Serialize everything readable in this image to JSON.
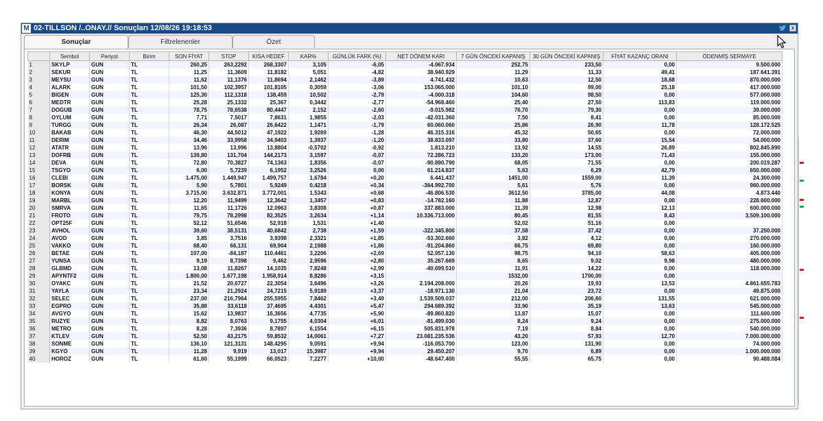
{
  "window": {
    "app_icon": "M",
    "title": "02-TILLSON /..ONAY.// Sonuçları  12/08/26 19:18:53",
    "close_label": "x"
  },
  "tabs": [
    "Sonuçlar",
    "Filtrelenenler",
    "Özet"
  ],
  "columns": [
    "",
    "Sembol",
    "Periyot",
    "Birim",
    "SON FİYAT",
    "STOP",
    "KISA HEDEF",
    "KAR%",
    "GÜNLÜK FARK (%)",
    "NET DÖNEM KARI",
    "7 GÜN ÖNCEKİ KAPANIŞ",
    "30 GÜN ÖNCEKİ KAPANIŞ",
    "FİYAT KAZANÇ ORANI",
    "ÖDENMİŞ SERMAYE"
  ],
  "rows": [
    [
      "1",
      "SKYLP",
      "GUN",
      "TL",
      "260,25",
      "263,2292",
      "268,3307",
      "3,105",
      "-6,05",
      "-4.067.934",
      "252,75",
      "233,50",
      "0,00",
      "9.500.000"
    ],
    [
      "2",
      "SEKUR",
      "GUN",
      "TL",
      "11,25",
      "11,3609",
      "11,8182",
      "5,051",
      "-4,82",
      "38.940.929",
      "11,29",
      "11,33",
      "49,41",
      "187.641.391"
    ],
    [
      "3",
      "MEYSU",
      "GUN",
      "TL",
      "11,62",
      "11,1376",
      "11,8694",
      "2,1462",
      "-3,89",
      "4.741.432",
      "10,63",
      "12,50",
      "18,68",
      "870.000.000"
    ],
    [
      "4",
      "ALARK",
      "GUN",
      "TL",
      "101,50",
      "102,3957",
      "101,8105",
      "0,3059",
      "-3,06",
      "153.065.000",
      "101,10",
      "99,00",
      "25,18",
      "417.000.000"
    ],
    [
      "5",
      "BIGEN",
      "GUN",
      "TL",
      "125,30",
      "112,1318",
      "138,459",
      "10,502",
      "-2,79",
      "-4.000.318",
      "104,60",
      "98,50",
      "0,00",
      "577.000.000"
    ],
    [
      "6",
      "MEDTR",
      "GUN",
      "TL",
      "25,28",
      "25,1332",
      "25,367",
      "0,3442",
      "-2,77",
      "-54.968.460",
      "25,40",
      "27,50",
      "113,83",
      "119.000.000"
    ],
    [
      "7",
      "DOGUB",
      "GUN",
      "TL",
      "78,75",
      "78,6538",
      "80,4447",
      "2,152",
      "-2,60",
      "-9.015.982",
      "76,70",
      "79,30",
      "0,00",
      "39.000.000"
    ],
    [
      "8",
      "OYLUM",
      "GUN",
      "TL",
      "7,71",
      "7,5017",
      "7,8631",
      "1,9855",
      "-2,03",
      "-42.031.360",
      "7,50",
      "8,41",
      "0,00",
      "85.000.000"
    ],
    [
      "9",
      "TURGG",
      "GUN",
      "TL",
      "26,34",
      "26,087",
      "26,6422",
      "1,1471",
      "-1,79",
      "60.060.060",
      "25,86",
      "26,90",
      "11,78",
      "128.172.525"
    ],
    [
      "10",
      "BAKAB",
      "GUN",
      "TL",
      "46,30",
      "44,5012",
      "47,1922",
      "1,9269",
      "-1,28",
      "46.315.316",
      "45,32",
      "50,65",
      "0,00",
      "72.000.000"
    ],
    [
      "11",
      "DERIM",
      "GUN",
      "TL",
      "34,46",
      "33,9958",
      "34,9403",
      "1,3937",
      "-1,20",
      "38.833.097",
      "33,80",
      "37,60",
      "15,54",
      "54.000.000"
    ],
    [
      "12",
      "ATATR",
      "GUN",
      "TL",
      "13,96",
      "13,996",
      "13,8804",
      "-0,5702",
      "-0,92",
      "1.813.210",
      "13,92",
      "14,55",
      "26,89",
      "802.845.890"
    ],
    [
      "13",
      "DOFRB",
      "GUN",
      "TL",
      "139,80",
      "131,704",
      "144,2173",
      "3,1597",
      "-0,07",
      "72.286.723",
      "133,20",
      "173,00",
      "71,43",
      "155.000.000"
    ],
    [
      "14",
      "DEVA",
      "GUN",
      "TL",
      "72,80",
      "70,3827",
      "74,1363",
      "1,8356",
      "-0,07",
      "-90.890.790",
      "68,05",
      "71,55",
      "0,00",
      "200.019.287"
    ],
    [
      "15",
      "TSGYO",
      "GUN",
      "TL",
      "6,00",
      "5,7239",
      "6,1952",
      "3,2526",
      "0,00",
      "61.214.837",
      "5,63",
      "6,29",
      "42,79",
      "650.000.000"
    ],
    [
      "16",
      "CLEBI",
      "GUN",
      "TL",
      "1.475,00",
      "1.449,947",
      "1.499,757",
      "1,6784",
      "+0,20",
      "6.441.437",
      "1451,00",
      "1559,00",
      "11,39",
      "24.300.000"
    ],
    [
      "17",
      "BORSK",
      "GUN",
      "TL",
      "5,90",
      "5,7801",
      "5,9249",
      "0,4218",
      "+0,34",
      "-364.992.700",
      "5,61",
      "5,76",
      "0,00",
      "960.000.000"
    ],
    [
      "18",
      "KONYA",
      "GUN",
      "TL",
      "3.715,00",
      "3.632,871",
      "3.772,001",
      "1,5343",
      "+0,68",
      "-46.806.530",
      "3612,50",
      "3785,00",
      "44,08",
      "4.873.440"
    ],
    [
      "19",
      "MARBL",
      "GUN",
      "TL",
      "12,20",
      "11,9499",
      "12,3642",
      "1,3457",
      "+0,83",
      "-14.782.160",
      "11,88",
      "12,87",
      "0,00",
      "228.600.000"
    ],
    [
      "20",
      "SMRVA",
      "GUN",
      "TL",
      "11,65",
      "11,1726",
      "12,0963",
      "3,8308",
      "+0,87",
      "337.883.000",
      "11,39",
      "12,98",
      "12,13",
      "600.000.000"
    ],
    [
      "21",
      "FROTO",
      "GUN",
      "TL",
      "79,75",
      "78,2998",
      "82,3525",
      "3,2634",
      "+1,14",
      "10.336.713.000",
      "80,45",
      "81,55",
      "8,43",
      "3.509.100.000"
    ],
    [
      "22",
      "OPT25F",
      "GUN",
      "TL",
      "52,12",
      "51,6546",
      "52,918",
      "1,531",
      "+1,40",
      "",
      "52,02",
      "51,16",
      "0,00",
      ""
    ],
    [
      "23",
      "AVHOL",
      "GUN",
      "TL",
      "39,60",
      "38,5131",
      "40,6842",
      "2,738",
      "+1,59",
      "-322.345.800",
      "37,58",
      "37,42",
      "0,00",
      "37.250.000"
    ],
    [
      "24",
      "AVOD",
      "GUN",
      "TL",
      "3,85",
      "3,7516",
      "3,9398",
      "2,3321",
      "+1,85",
      "-53.302.660",
      "3,82",
      "4,12",
      "0,00",
      "270.000.000"
    ],
    [
      "25",
      "VAKKO",
      "GUN",
      "TL",
      "68,40",
      "66,131",
      "69,904",
      "2,1988",
      "+1,86",
      "-91.204.860",
      "66,75",
      "69,80",
      "0,00",
      "160.000.000"
    ],
    [
      "26",
      "BETAE",
      "GUN",
      "TL",
      "107,00",
      "-84,187",
      "110,4461",
      "3,2206",
      "+2,69",
      "52.057.130",
      "98,75",
      "94,10",
      "58,63",
      "405.000.000"
    ],
    [
      "27",
      "YUNSA",
      "GUN",
      "TL",
      "9,19",
      "8,7398",
      "9,462",
      "2,9596",
      "+2,80",
      "35.267.669",
      "8,65",
      "9,02",
      "9,98",
      "480.000.000"
    ],
    [
      "28",
      "GLBMD",
      "GUN",
      "TL",
      "13,08",
      "11,8267",
      "14,1035",
      "7,8248",
      "+2,99",
      "-40.699.510",
      "11,91",
      "14,22",
      "0,00",
      "118.000.000"
    ],
    [
      "29",
      "APYNTF2",
      "GUN",
      "TL",
      "1.800,00",
      "1.677,198",
      "1.958,914",
      "8,8286",
      "+3,15",
      "",
      "1532,00",
      "1700,00",
      "0,00",
      ""
    ],
    [
      "30",
      "OYAKC",
      "GUN",
      "TL",
      "21,52",
      "20,6727",
      "22,3054",
      "3,6496",
      "+3,26",
      "2.194.208.000",
      "20,26",
      "19,93",
      "13,53",
      "4.861.655.783"
    ],
    [
      "31",
      "YAYLA",
      "GUN",
      "TL",
      "23,34",
      "21,2924",
      "24,7215",
      "5,9189",
      "+3,37",
      "-18.971.130",
      "21,04",
      "23,72",
      "0,00",
      "49.875.000"
    ],
    [
      "32",
      "SELEC",
      "GUN",
      "TL",
      "237,00",
      "216,7964",
      "255,5955",
      "7,8462",
      "+3,49",
      "1.539.509.037",
      "212,00",
      "206,60",
      "131,55",
      "621.000.000"
    ],
    [
      "33",
      "EGPRO",
      "GUN",
      "TL",
      "35,88",
      "33,6118",
      "37,4695",
      "4,4301",
      "+5,47",
      "294.689.392",
      "33,90",
      "35,19",
      "13,63",
      "545.000.000"
    ],
    [
      "34",
      "AVGYO",
      "GUN",
      "TL",
      "15,62",
      "13,9837",
      "16,3656",
      "4,7735",
      "+5,90",
      "-89.860.820",
      "13,87",
      "15,07",
      "0,00",
      "111.600.000"
    ],
    [
      "35",
      "RUZYE",
      "GUN",
      "TL",
      "8,82",
      "8,0763",
      "9,1755",
      "4,0304",
      "+6,01",
      "-81.499.030",
      "8,24",
      "9,24",
      "0,00",
      "275.000.000"
    ],
    [
      "36",
      "METRO",
      "GUN",
      "TL",
      "8,28",
      "7,3936",
      "8,7897",
      "6,1554",
      "+6,15",
      "505.831.978",
      "7,19",
      "8,84",
      "0,00",
      "540.000.000"
    ],
    [
      "37",
      "KTLEV",
      "GUN",
      "TL",
      "52,50",
      "43,2175",
      "59,8532",
      "14,0061",
      "+7,27",
      "23.081.235.536",
      "43,20",
      "57,93",
      "12,70",
      "7.000.000.000"
    ],
    [
      "38",
      "SONME",
      "GUN",
      "TL",
      "136,10",
      "121,3131",
      "148,4295",
      "9,0591",
      "+9,94",
      "-116.053.700",
      "123,00",
      "131,90",
      "0,00",
      "74.000.000"
    ],
    [
      "39",
      "KGYO",
      "GUN",
      "TL",
      "11,28",
      "9,919",
      "13,017",
      "15,3987",
      "+9,94",
      "29.450.207",
      "9,70",
      "6,89",
      "0,00",
      "1.000.000.000"
    ],
    [
      "40",
      "HOROZ",
      "GUN",
      "TL",
      "61,60",
      "55,1999",
      "66,0523",
      "7,2277",
      "+10,00",
      "-48.647.400",
      "55,55",
      "65,75",
      "0,00",
      "90.488.084"
    ]
  ]
}
